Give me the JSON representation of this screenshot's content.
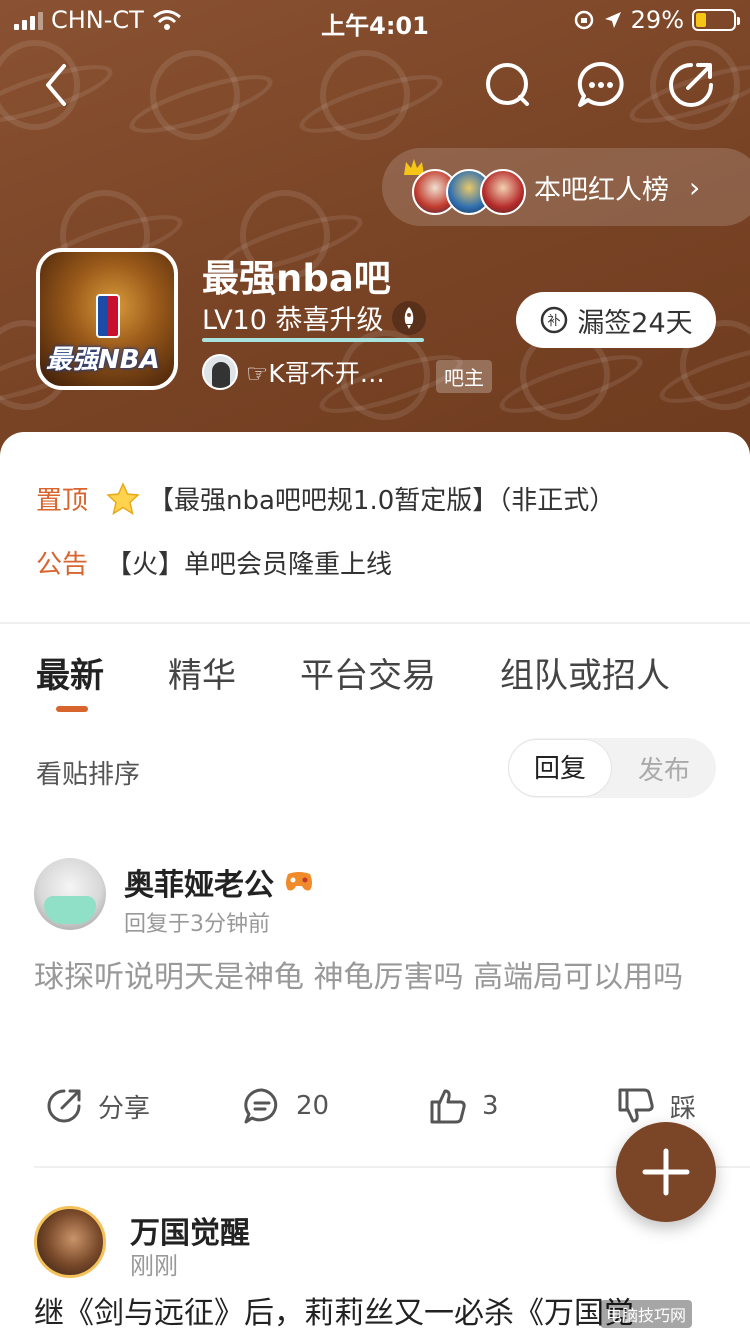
{
  "status_bar": {
    "carrier": "CHN-CT",
    "time": "上午4:01",
    "battery": "29%",
    "battery_level": 0.29
  },
  "header": {
    "rank_label": "本吧红人榜",
    "forum_name": "最强nba吧",
    "level_text": "LV10 恭喜升级",
    "owner_name": "☞K哥不开…",
    "owner_badge": "吧主",
    "sign_label": "漏签24天",
    "forum_avatar_text": "最强NBA",
    "icons": [
      "back-icon",
      "search-icon",
      "chat-icon",
      "share-icon",
      "rocket-icon",
      "calendar-icon"
    ]
  },
  "notices": [
    {
      "tag": "置顶",
      "text": "【最强nba吧吧规1.0暂定版】（非正式）"
    },
    {
      "tag": "公告",
      "text": "【火】单吧会员隆重上线"
    }
  ],
  "tabs": [
    "最新",
    "精华",
    "平台交易",
    "组队或招人"
  ],
  "sort": {
    "label": "看贴排序",
    "options": [
      "回复",
      "发布"
    ],
    "active": "回复"
  },
  "posts": [
    {
      "author": "奥菲娅老公",
      "time": "回复于3分钟前",
      "body": "球探听说明天是神龟 神龟厉害吗 高端局可以用吗",
      "actions": {
        "share": "分享",
        "comments": "20",
        "likes": "3",
        "dislike": "踩"
      }
    },
    {
      "author": "万国觉醒",
      "time": "刚刚",
      "body": "继《剑与远征》后，莉莉丝又一必杀《万国觉"
    }
  ],
  "watermark": "电脑技巧网"
}
